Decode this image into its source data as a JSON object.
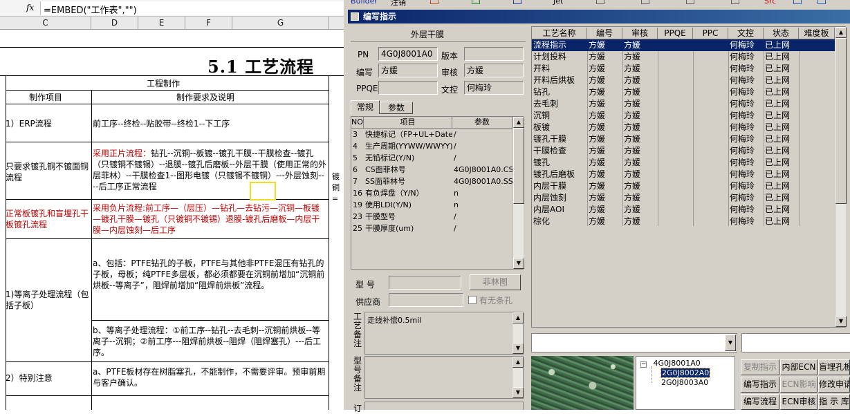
{
  "spreadsheet": {
    "fx_label": "fx",
    "formula": "=EMBED(\"工作表\",\"\")",
    "columns": [
      "C",
      "D",
      "E",
      "F",
      "G"
    ],
    "title": "5.1 工艺流程",
    "section_header": "工程制作",
    "col1_header": "制作项目",
    "col2_header": "制作要求及说明",
    "rows": [
      {
        "item": "1）ERP流程",
        "desc": "前工序--终检--贴胶带--终检1--下工序"
      },
      {
        "item": "只要求镀孔铜不镀面铜流程",
        "desc_red": "采用正片流程：",
        "desc": "钻孔--沉铜--板镀--镀孔干膜--干膜检查--镀孔（只镀铜不镀锡）--退膜--镀孔后磨板--外层干膜（使用正常的外层菲林）--干膜检查1--图形电镀（只镀锡不镀铜）---外层蚀刻----后工序正常流程"
      },
      {
        "item": "正常板镀孔和盲埋孔干板镀孔流程",
        "desc": "采用负片流程:前工序—（层压）—钻孔—去钻污—沉铜—板镀—镀孔干膜—镀孔（只镀铜不镀锡）退膜-镀孔后磨板—内层干膜—内层蚀刻—后工序"
      },
      {
        "item": "1)等离子处理流程（包括子板）",
        "desc_a": "a、包括：PTFE钻孔的子板，PTFE与其他非PTFE混压有钻孔的子板，母板；纯PTFE多层板，都必须都要在沉铜前增加“沉铜前烘板--等离子”，阻焊前增加“阻焊前烘板”流程。",
        "desc_b": "b、等离子处理流程：①前工序--钻孔--去毛刺--沉铜前烘板--等离子--沉铜；②前工序---阻焊前烘板--阻焊（阻焊塞孔）---后工序。"
      },
      {
        "item": "2）特别注意",
        "desc": "a、PTFE板材存在树脂塞孔，不能制作，不需要评审。预审前期与客户确认。"
      }
    ],
    "right_edge_text": [
      "镀",
      "铜",
      "="
    ]
  },
  "toolbar": {
    "items": [
      "Builder",
      "注销",
      "Jet",
      "Src"
    ]
  },
  "window": {
    "title": "编写指示",
    "group_title": "外层干膜",
    "pn_label": "PN",
    "pn_value": "4G0J8001A0",
    "version_label": "版本",
    "version_value": "",
    "writer_label": "编写",
    "writer_value": "方媛",
    "reviewer_label": "审核",
    "reviewer_value": "方媛",
    "ppqe_label": "PPQE",
    "ppqe_value": "",
    "docctrl_label": "文控",
    "docctrl_value": "何梅玲",
    "tabs": [
      "常规",
      "参数"
    ],
    "param_headers": [
      "NO",
      "项目",
      "参数"
    ],
    "params": [
      {
        "no": "3",
        "item": "快捷标记（FP+UL+DateC",
        "value": "/"
      },
      {
        "no": "4",
        "item": "生产周期(YYWW/WWYY)",
        "value": "/"
      },
      {
        "no": "5",
        "item": "无铅标记(Y/N)",
        "value": "/"
      },
      {
        "no": "6",
        "item": "CS面菲林号",
        "value": "4G0J8001A0.CS"
      },
      {
        "no": "7",
        "item": "SS面菲林号",
        "value": "4G0J8001A0.SS"
      },
      {
        "no": "16",
        "item": "有负焊盘（Y/N）",
        "value": "n"
      },
      {
        "no": "19",
        "item": "使用LDI(Y/N)",
        "value": "n"
      },
      {
        "no": "23",
        "item": "干膜型号",
        "value": "/"
      },
      {
        "no": "25",
        "item": "干膜厚度(um)",
        "value": "/"
      }
    ],
    "model_label": "型  号",
    "model_value": "",
    "film_button": "菲林图",
    "supplier_label": "供应商",
    "supplier_value": "",
    "no_hole_label": "有无条孔",
    "process_note_label": "工艺备注",
    "process_note": "走线补偿0.5mil",
    "model_note_label": "型号备注",
    "model_note": "",
    "extra_label": "订",
    "table_headers": [
      "工艺名称",
      "编号",
      "审核",
      "PPQE",
      "PPC",
      "文控",
      "状态",
      "难度板"
    ],
    "table_rows": [
      {
        "name": "流程指示",
        "writer": "方媛",
        "reviewer": "方媛",
        "ppqe": "",
        "ppc": "",
        "docctrl": "何梅玲",
        "status": "已上网"
      },
      {
        "name": "计划投料",
        "writer": "方媛",
        "reviewer": "方媛",
        "ppqe": "",
        "ppc": "",
        "docctrl": "何梅玲",
        "status": "已上网"
      },
      {
        "name": "开料",
        "writer": "方媛",
        "reviewer": "方媛",
        "ppqe": "",
        "ppc": "",
        "docctrl": "何梅玲",
        "status": "已上网"
      },
      {
        "name": "开料后烘板",
        "writer": "方媛",
        "reviewer": "方媛",
        "ppqe": "",
        "ppc": "",
        "docctrl": "何梅玲",
        "status": "已上网"
      },
      {
        "name": "钻孔",
        "writer": "方媛",
        "reviewer": "方媛",
        "ppqe": "",
        "ppc": "",
        "docctrl": "何梅玲",
        "status": "已上网"
      },
      {
        "name": "去毛刺",
        "writer": "方媛",
        "reviewer": "方媛",
        "ppqe": "",
        "ppc": "",
        "docctrl": "何梅玲",
        "status": "已上网"
      },
      {
        "name": "沉铜",
        "writer": "方媛",
        "reviewer": "方媛",
        "ppqe": "",
        "ppc": "",
        "docctrl": "何梅玲",
        "status": "已上网"
      },
      {
        "name": "板镀",
        "writer": "方媛",
        "reviewer": "方媛",
        "ppqe": "",
        "ppc": "",
        "docctrl": "何梅玲",
        "status": "已上网"
      },
      {
        "name": "镀孔干膜",
        "writer": "方媛",
        "reviewer": "方媛",
        "ppqe": "",
        "ppc": "",
        "docctrl": "何梅玲",
        "status": "已上网"
      },
      {
        "name": "干膜检查",
        "writer": "方媛",
        "reviewer": "方媛",
        "ppqe": "",
        "ppc": "",
        "docctrl": "何梅玲",
        "status": "已上网"
      },
      {
        "name": "镀孔",
        "writer": "方媛",
        "reviewer": "方媛",
        "ppqe": "",
        "ppc": "",
        "docctrl": "何梅玲",
        "status": "已上网"
      },
      {
        "name": "镀孔后磨板",
        "writer": "方媛",
        "reviewer": "方媛",
        "ppqe": "",
        "ppc": "",
        "docctrl": "何梅玲",
        "status": "已上网"
      },
      {
        "name": "内层干膜",
        "writer": "方媛",
        "reviewer": "方媛",
        "ppqe": "",
        "ppc": "",
        "docctrl": "何梅玲",
        "status": "已上网"
      },
      {
        "name": "内层蚀刻",
        "writer": "方媛",
        "reviewer": "方媛",
        "ppqe": "",
        "ppc": "",
        "docctrl": "何梅玲",
        "status": "已上网"
      },
      {
        "name": "内层AOI",
        "writer": "方媛",
        "reviewer": "方媛",
        "ppqe": "",
        "ppc": "",
        "docctrl": "何梅玲",
        "status": "已上网"
      },
      {
        "name": "棕化",
        "writer": "方媛",
        "reviewer": "方媛",
        "ppqe": "",
        "ppc": "",
        "docctrl": "何梅玲",
        "status": "已上网"
      }
    ],
    "tree_root": "4G0J8001A0",
    "tree_children": [
      "2G0J8002A0",
      "2G0J8003A0"
    ],
    "buttons": [
      "复制指示",
      "内部ECN",
      "盲埋孔板",
      "编写指示",
      "ECN影响",
      "修改申请",
      "编写流程",
      "ECN审核",
      "指 示 库"
    ]
  }
}
